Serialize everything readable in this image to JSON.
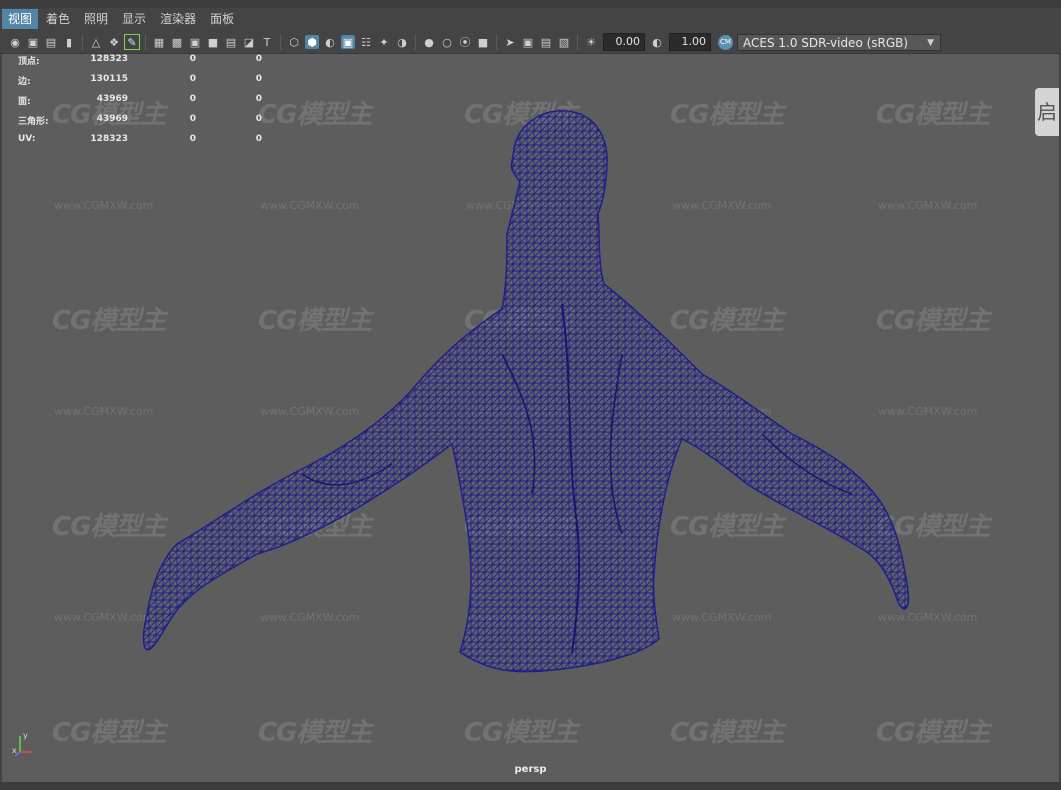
{
  "menu": [
    "视图",
    "着色",
    "照明",
    "显示",
    "渲染器",
    "面板"
  ],
  "toolbar": {
    "exposure": "0.00",
    "gamma": "1.00",
    "color_management": "ACES 1.0 SDR-video (sRGB)"
  },
  "hud": {
    "rows": [
      {
        "label": "顶点:",
        "v1": "128323",
        "v2": "0",
        "v3": "0"
      },
      {
        "label": "边:",
        "v1": "130115",
        "v2": "0",
        "v3": "0"
      },
      {
        "label": "面:",
        "v1": "43969",
        "v2": "0",
        "v3": "0"
      },
      {
        "label": "三角形:",
        "v1": "43969",
        "v2": "0",
        "v3": "0"
      },
      {
        "label": "UV:",
        "v1": "128323",
        "v2": "0",
        "v3": "0"
      }
    ]
  },
  "watermark": {
    "logo": "CG模型主",
    "url": "www.CGMXW.com"
  },
  "side_tab": "启",
  "axis": {
    "y": "y",
    "x": "x"
  },
  "camera": "persp",
  "colors": {
    "wireframe": "#1f1f8a",
    "viewport_bg": "#5d5d5d",
    "menu_active": "#5285a6"
  }
}
